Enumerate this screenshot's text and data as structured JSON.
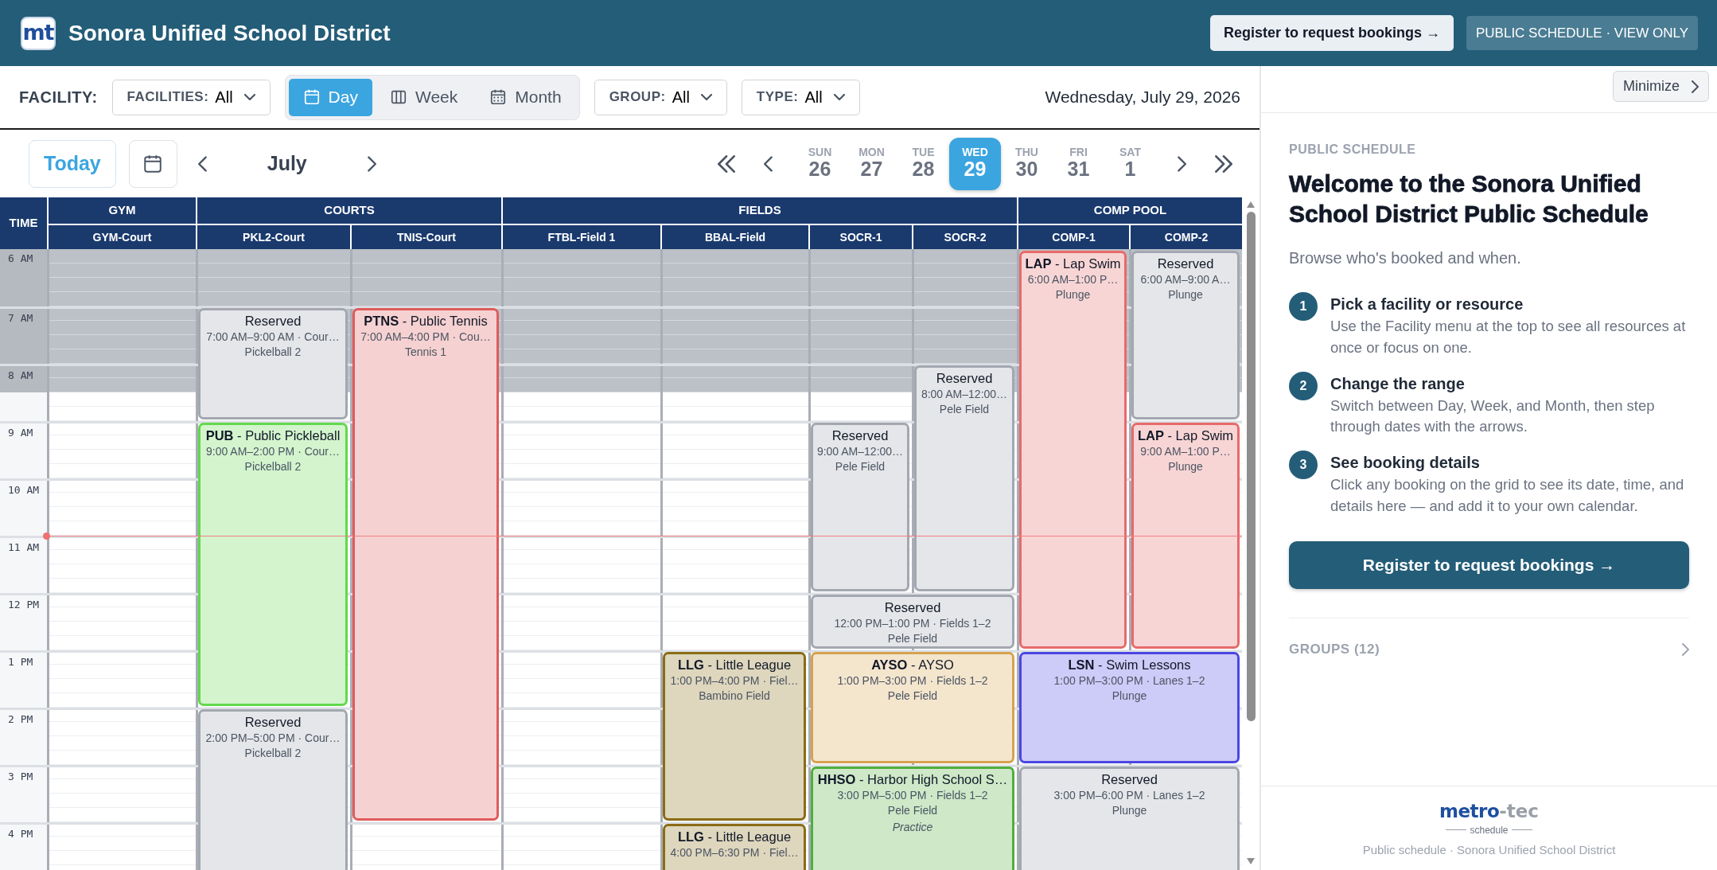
{
  "header": {
    "logo": "mt",
    "title": "Sonora Unified School District",
    "register_button": "Register to request bookings →",
    "mode_badge": "PUBLIC SCHEDULE · VIEW ONLY"
  },
  "toolbar": {
    "facility_label": "FACILITY:",
    "facilities_filter": {
      "label": "FACILITIES:",
      "value": "All"
    },
    "views": [
      {
        "kind": "day",
        "label": "Day",
        "selected": true
      },
      {
        "kind": "week",
        "label": "Week",
        "selected": false
      },
      {
        "kind": "month",
        "label": "Month",
        "selected": false
      }
    ],
    "group_filter": {
      "label": "GROUP:",
      "value": "All"
    },
    "type_filter": {
      "label": "TYPE:",
      "value": "All"
    },
    "current_date": "Wednesday, July 29, 2026"
  },
  "navigator": {
    "today_button": "Today",
    "month": "July",
    "days": [
      {
        "weekday": "SUN",
        "date": "26",
        "selected": false
      },
      {
        "weekday": "MON",
        "date": "27",
        "selected": false
      },
      {
        "weekday": "TUE",
        "date": "28",
        "selected": false
      },
      {
        "weekday": "WED",
        "date": "29",
        "selected": true
      },
      {
        "weekday": "THU",
        "date": "30",
        "selected": false
      },
      {
        "weekday": "FRI",
        "date": "31",
        "selected": false
      },
      {
        "weekday": "SAT",
        "date": "1",
        "selected": false
      }
    ]
  },
  "schedule": {
    "time_header": "TIME",
    "now_marker": true,
    "groups": [
      {
        "name": "GYM",
        "resources": [
          {
            "name": "GYM-Court",
            "closed_morning": true
          }
        ]
      },
      {
        "name": "COURTS",
        "resources": [
          {
            "name": "PKL2-Court",
            "closed_morning": true
          },
          {
            "name": "TNIS-Court",
            "closed_morning": true
          }
        ]
      },
      {
        "name": "FIELDS",
        "resources": [
          {
            "name": "FTBL-Field 1",
            "closed_morning": true
          },
          {
            "name": "BBAL-Field",
            "closed_morning": true
          },
          {
            "name": "SOCR-1",
            "closed_morning": true
          },
          {
            "name": "SOCR-2",
            "closed_morning": true
          }
        ]
      },
      {
        "name": "COMP POOL",
        "resources": [
          {
            "name": "COMP-1",
            "closed_morning": true
          },
          {
            "name": "COMP-2",
            "closed_morning": true
          }
        ]
      }
    ],
    "time_labels": [
      "6 AM",
      "7 AM",
      "8 AM",
      "9 AM",
      "10 AM",
      "11 AM",
      "12 PM",
      "1 PM",
      "2 PM",
      "3 PM",
      "4 PM"
    ],
    "events": [
      {
        "title": "Reserved",
        "time": "7:00 AM–9:00 AM · Cour…",
        "location": "Pickelball 2",
        "color": "#a3a7b0"
      },
      {
        "title": "**PUB** - Public Pickleball",
        "time": "9:00 AM–2:00 PM · Cour…",
        "location": "Pickelball 2",
        "color": "#62d94c"
      },
      {
        "title": "Reserved",
        "time": "2:00 PM–5:00 PM · Cour…",
        "location": "Pickelball 2",
        "color": "#a3a7b0"
      },
      {
        "title": "**PTNS** - Public Tennis",
        "time": "7:00 AM–4:00 PM · Cou…",
        "location": "Tennis 1",
        "color": "#df5b5b"
      },
      {
        "title": "**LLG** - Little League",
        "time": "1:00 PM–4:00 PM · Fiel…",
        "location": "Bambino Field",
        "color": "#8a6c14"
      },
      {
        "title": "**LLG** - Little League",
        "time": "4:00 PM–6:30 PM · Fiel…",
        "color": "#8a6c14"
      },
      {
        "title": "Reserved",
        "time": "9:00 AM–12:00…",
        "location": "Pele Field",
        "color": "#a3a7b0"
      },
      {
        "title": "Reserved",
        "time": "8:00 AM–12:00…",
        "location": "Pele Field",
        "color": "#a3a7b0"
      },
      {
        "title": "Reserved",
        "time": "12:00 PM–1:00 PM · Fields 1–2",
        "location": "Pele Field",
        "color": "#a3a7b0"
      },
      {
        "title": "**AYSO** - AYSO",
        "time": "1:00 PM–3:00 PM · Fields 1–2",
        "location": "Pele Field",
        "color": "#d6a24e"
      },
      {
        "title": "**HHSO** - Harbor High School S…",
        "time": "3:00 PM–5:00 PM · Fields 1–2",
        "location": "Pele Field",
        "note": "Practice",
        "color": "#4fae3c"
      },
      {
        "title": "**LAP** - Lap Swim",
        "time": "6:00 AM–1:00 P…",
        "location": "Plunge",
        "color": "#e76a6a"
      },
      {
        "title": "Reserved",
        "time": "6:00 AM–9:00 A…",
        "location": "Plunge",
        "color": "#a3a7b0"
      },
      {
        "title": "**LAP** - Lap Swim",
        "time": "9:00 AM–1:00 P…",
        "location": "Plunge",
        "color": "#e76a6a"
      },
      {
        "title": "**LSN** - Swim Lessons",
        "time": "1:00 PM–3:00 PM · Lanes 1–2",
        "location": "Plunge",
        "color": "#4b46e2"
      },
      {
        "title": "Reserved",
        "time": "3:00 PM–6:00 PM · Lanes 1–2",
        "location": "Plunge",
        "color": "#a3a7b0"
      }
    ]
  },
  "panel": {
    "minimize_button": "Minimize",
    "eyebrow": "PUBLIC SCHEDULE",
    "heading": "Welcome to the Sonora Unified School District Public Schedule",
    "intro": "Browse who's booked and when.",
    "steps": [
      {
        "number": "1",
        "title": "Pick a facility or resource",
        "text": "Use the Facility menu at the top to see all resources at once or focus on one."
      },
      {
        "number": "2",
        "title": "Change the range",
        "text": "Switch between Day, Week, and Month, then step through dates with the arrows."
      },
      {
        "number": "3",
        "title": "See booking details",
        "text": "Click any booking on the grid to see its date, time, and details here — and add it to your own calendar."
      }
    ],
    "register_button": "Register to request bookings →",
    "groups_toggle": {
      "label": "GROUPS (12)",
      "expanded": false
    },
    "footer_logo": {
      "brand_main": "metro",
      "brand_suffix": "-tec",
      "tagline": "schedule"
    },
    "footer_text": "Public schedule · Sonora Unified School District"
  }
}
